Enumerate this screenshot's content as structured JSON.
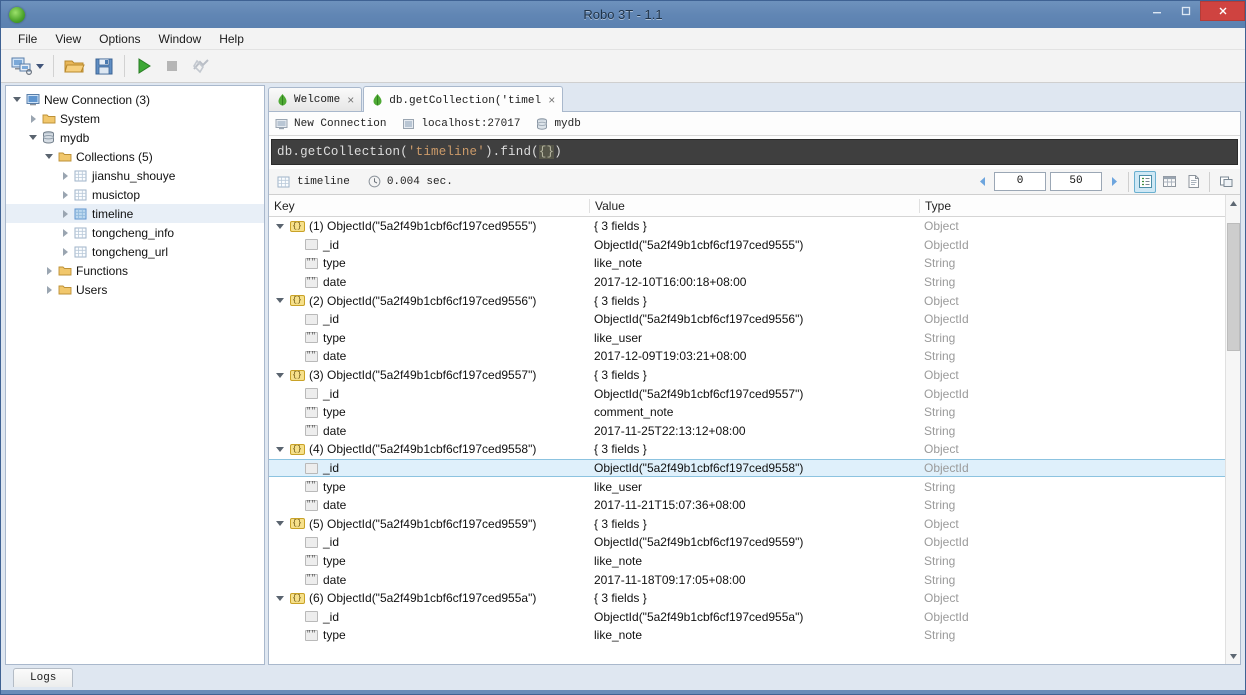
{
  "window": {
    "title": "Robo 3T - 1.1",
    "app_icon": "mongodb-leaf-icon",
    "controls": {
      "minimize": "minimize-icon",
      "maximize": "maximize-icon",
      "close": "close-icon"
    }
  },
  "menubar": {
    "items": [
      {
        "label": "File"
      },
      {
        "label": "View"
      },
      {
        "label": "Options"
      },
      {
        "label": "Window"
      },
      {
        "label": "Help"
      }
    ]
  },
  "toolbar": {
    "items": [
      {
        "name": "connect-button",
        "icon": "computer-connect-icon",
        "has_dropdown": true
      },
      {
        "name": "open-script-button",
        "icon": "folder-open-icon"
      },
      {
        "name": "save-script-button",
        "icon": "floppy-save-icon"
      },
      {
        "name": "execute-button",
        "icon": "play-icon"
      },
      {
        "name": "stop-button",
        "icon": "stop-square-icon"
      },
      {
        "name": "explain-button",
        "icon": "explain-icon"
      }
    ]
  },
  "sidebar": {
    "nodes": [
      {
        "label": "New Connection (3)",
        "icon": "server-icon",
        "depth": 0,
        "expanded": true,
        "twisty": "open"
      },
      {
        "label": "System",
        "icon": "folder-icon",
        "depth": 1,
        "expanded": false,
        "twisty": "closed"
      },
      {
        "label": "mydb",
        "icon": "database-icon",
        "depth": 1,
        "expanded": true,
        "twisty": "open"
      },
      {
        "label": "Collections (5)",
        "icon": "folder-icon",
        "depth": 2,
        "expanded": true,
        "twisty": "open"
      },
      {
        "label": "jianshu_shouye",
        "icon": "collection-icon",
        "depth": 3,
        "expanded": false,
        "twisty": "closed"
      },
      {
        "label": "musictop",
        "icon": "collection-icon",
        "depth": 3,
        "expanded": false,
        "twisty": "closed"
      },
      {
        "label": "timeline",
        "icon": "collection-icon",
        "depth": 3,
        "expanded": false,
        "twisty": "closed",
        "selected": true
      },
      {
        "label": "tongcheng_info",
        "icon": "collection-icon",
        "depth": 3,
        "expanded": false,
        "twisty": "closed"
      },
      {
        "label": "tongcheng_url",
        "icon": "collection-icon",
        "depth": 3,
        "expanded": false,
        "twisty": "closed"
      },
      {
        "label": "Functions",
        "icon": "folder-icon",
        "depth": 2,
        "expanded": false,
        "twisty": "closed"
      },
      {
        "label": "Users",
        "icon": "folder-icon",
        "depth": 2,
        "expanded": false,
        "twisty": "closed"
      }
    ]
  },
  "tabs": [
    {
      "label": "Welcome",
      "icon": "mongodb-leaf-icon",
      "active": false,
      "close": "×"
    },
    {
      "label": "db.getCollection('timelin⋯",
      "icon": "mongodb-leaf-icon",
      "active": true,
      "close": "×"
    }
  ],
  "breadcrumb": [
    {
      "label": "New Connection",
      "icon": "computer-icon"
    },
    {
      "label": "localhost:27017",
      "icon": "server-small-icon"
    },
    {
      "label": "mydb",
      "icon": "database-icon"
    }
  ],
  "editor": {
    "prefix": "db.getCollection(",
    "string": "'timeline'",
    "middle": ").find(",
    "braces": "{}",
    "suffix": ")"
  },
  "results_bar": {
    "collection": "timeline",
    "collection_icon": "collection-icon",
    "time_icon": "clock-icon",
    "time": "0.004 sec.",
    "prev_icon": "arrow-left-icon",
    "next_icon": "arrow-right-icon",
    "skip": "0",
    "limit": "50",
    "view_modes": [
      {
        "name": "tree-view-button",
        "icon": "tree-view-icon",
        "active": true
      },
      {
        "name": "table-view-button",
        "icon": "table-view-icon",
        "active": false
      },
      {
        "name": "text-view-button",
        "icon": "text-view-icon",
        "active": false
      }
    ],
    "maximize_icon": "maximize-pane-icon"
  },
  "grid": {
    "columns": [
      "Key",
      "Value",
      "Type"
    ],
    "rows": [
      {
        "key": "(1) ObjectId(\"5a2f49b1cbf6cf197ced9555\")",
        "value": "{ 3 fields }",
        "type": "Object",
        "icon": "document-icon",
        "level": 0,
        "twisty": "open"
      },
      {
        "key": "_id",
        "value": "ObjectId(\"5a2f49b1cbf6cf197ced9555\")",
        "type": "ObjectId",
        "icon": "objectid-icon",
        "level": 1
      },
      {
        "key": "type",
        "value": "like_note",
        "type": "String",
        "icon": "string-icon",
        "level": 1
      },
      {
        "key": "date",
        "value": "2017-12-10T16:00:18+08:00",
        "type": "String",
        "icon": "string-icon",
        "level": 1
      },
      {
        "key": "(2) ObjectId(\"5a2f49b1cbf6cf197ced9556\")",
        "value": "{ 3 fields }",
        "type": "Object",
        "icon": "document-icon",
        "level": 0,
        "twisty": "open"
      },
      {
        "key": "_id",
        "value": "ObjectId(\"5a2f49b1cbf6cf197ced9556\")",
        "type": "ObjectId",
        "icon": "objectid-icon",
        "level": 1
      },
      {
        "key": "type",
        "value": "like_user",
        "type": "String",
        "icon": "string-icon",
        "level": 1
      },
      {
        "key": "date",
        "value": "2017-12-09T19:03:21+08:00",
        "type": "String",
        "icon": "string-icon",
        "level": 1
      },
      {
        "key": "(3) ObjectId(\"5a2f49b1cbf6cf197ced9557\")",
        "value": "{ 3 fields }",
        "type": "Object",
        "icon": "document-icon",
        "level": 0,
        "twisty": "open"
      },
      {
        "key": "_id",
        "value": "ObjectId(\"5a2f49b1cbf6cf197ced9557\")",
        "type": "ObjectId",
        "icon": "objectid-icon",
        "level": 1
      },
      {
        "key": "type",
        "value": "comment_note",
        "type": "String",
        "icon": "string-icon",
        "level": 1
      },
      {
        "key": "date",
        "value": "2017-11-25T22:13:12+08:00",
        "type": "String",
        "icon": "string-icon",
        "level": 1
      },
      {
        "key": "(4) ObjectId(\"5a2f49b1cbf6cf197ced9558\")",
        "value": "{ 3 fields }",
        "type": "Object",
        "icon": "document-icon",
        "level": 0,
        "twisty": "open"
      },
      {
        "key": "_id",
        "value": "ObjectId(\"5a2f49b1cbf6cf197ced9558\")",
        "type": "ObjectId",
        "icon": "objectid-icon",
        "level": 1,
        "selected": true
      },
      {
        "key": "type",
        "value": "like_user",
        "type": "String",
        "icon": "string-icon",
        "level": 1
      },
      {
        "key": "date",
        "value": "2017-11-21T15:07:36+08:00",
        "type": "String",
        "icon": "string-icon",
        "level": 1
      },
      {
        "key": "(5) ObjectId(\"5a2f49b1cbf6cf197ced9559\")",
        "value": "{ 3 fields }",
        "type": "Object",
        "icon": "document-icon",
        "level": 0,
        "twisty": "open"
      },
      {
        "key": "_id",
        "value": "ObjectId(\"5a2f49b1cbf6cf197ced9559\")",
        "type": "ObjectId",
        "icon": "objectid-icon",
        "level": 1
      },
      {
        "key": "type",
        "value": "like_note",
        "type": "String",
        "icon": "string-icon",
        "level": 1
      },
      {
        "key": "date",
        "value": "2017-11-18T09:17:05+08:00",
        "type": "String",
        "icon": "string-icon",
        "level": 1
      },
      {
        "key": "(6) ObjectId(\"5a2f49b1cbf6cf197ced955a\")",
        "value": "{ 3 fields }",
        "type": "Object",
        "icon": "document-icon",
        "level": 0,
        "twisty": "open"
      },
      {
        "key": "_id",
        "value": "ObjectId(\"5a2f49b1cbf6cf197ced955a\")",
        "type": "ObjectId",
        "icon": "objectid-icon",
        "level": 1
      },
      {
        "key": "type",
        "value": "like_note",
        "type": "String",
        "icon": "string-icon",
        "level": 1
      }
    ]
  },
  "bottom": {
    "logs_label": "Logs"
  },
  "colors": {
    "titlebar": "#6186b4",
    "close_button": "#cf4340",
    "selection": "#dff0fb",
    "editor_bg": "#3f3f3f",
    "accent": "#4ba32a"
  }
}
